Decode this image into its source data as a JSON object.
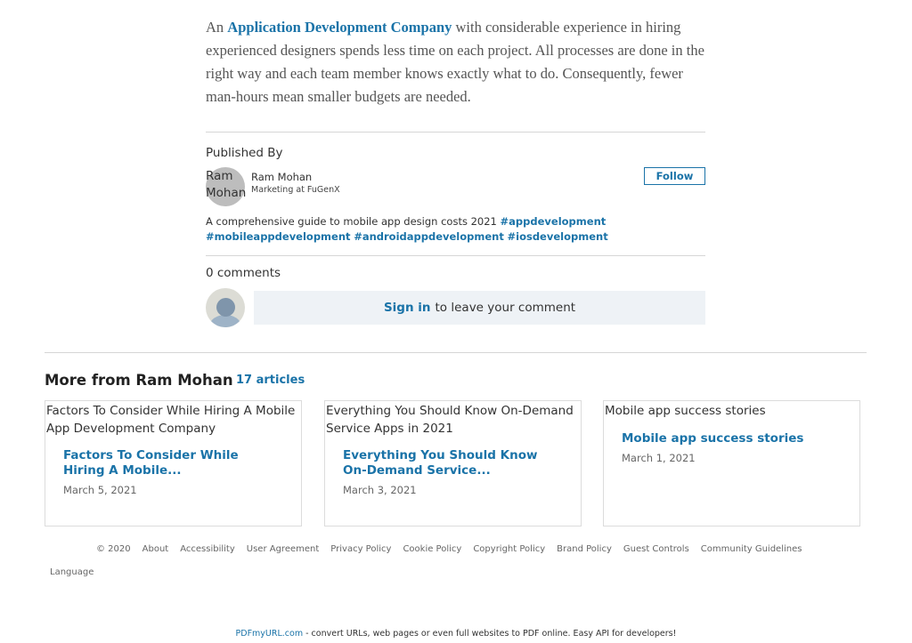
{
  "article": {
    "prefix": "An ",
    "link_text": "Application Development Company",
    "body": " with considerable experience in hiring experienced designers spends less time on each project. All processes are done in the right way and each team member knows exactly what to do. Consequently, fewer man-hours mean smaller budgets are needed."
  },
  "publisher": {
    "label": "Published By",
    "avatar_alt": "Ram Mohan",
    "name": "Ram Mohan",
    "title": "Marketing at FuGenX",
    "follow_label": "Follow"
  },
  "tagline": {
    "text": "A comprehensive guide to mobile app design costs 2021 ",
    "tags": [
      "#appdevelopment",
      "#mobileappdevelopment",
      "#androidappdevelopment",
      "#iosdevelopment"
    ]
  },
  "comments": {
    "count_label": "0 comments",
    "signin_label": "Sign in",
    "prompt_text": "to leave your comment"
  },
  "more": {
    "heading": "More from Ram Mohan",
    "count": "17 articles",
    "cards": [
      {
        "img_alt": "Factors To Consider While Hiring A Mobile App Development Company",
        "title": "Factors To Consider While Hiring A Mobile...",
        "date": "March 5, 2021"
      },
      {
        "img_alt": "Everything You Should Know On-Demand Service Apps in 2021",
        "title": "Everything You Should Know On-Demand Service...",
        "date": "March 3, 2021"
      },
      {
        "img_alt": "Mobile app success stories",
        "title": "Mobile app success stories",
        "date": "March 1, 2021"
      }
    ]
  },
  "footer": {
    "links": [
      "© 2020",
      "About",
      "Accessibility",
      "User Agreement",
      "Privacy Policy",
      "Cookie Policy",
      "Copyright Policy",
      "Brand Policy",
      "Guest Controls",
      "Community Guidelines"
    ],
    "language": "Language"
  },
  "pdf_bar": {
    "link": "PDFmyURL.com",
    "text": " - convert URLs, web pages or even full websites to PDF online. Easy API for developers!"
  }
}
